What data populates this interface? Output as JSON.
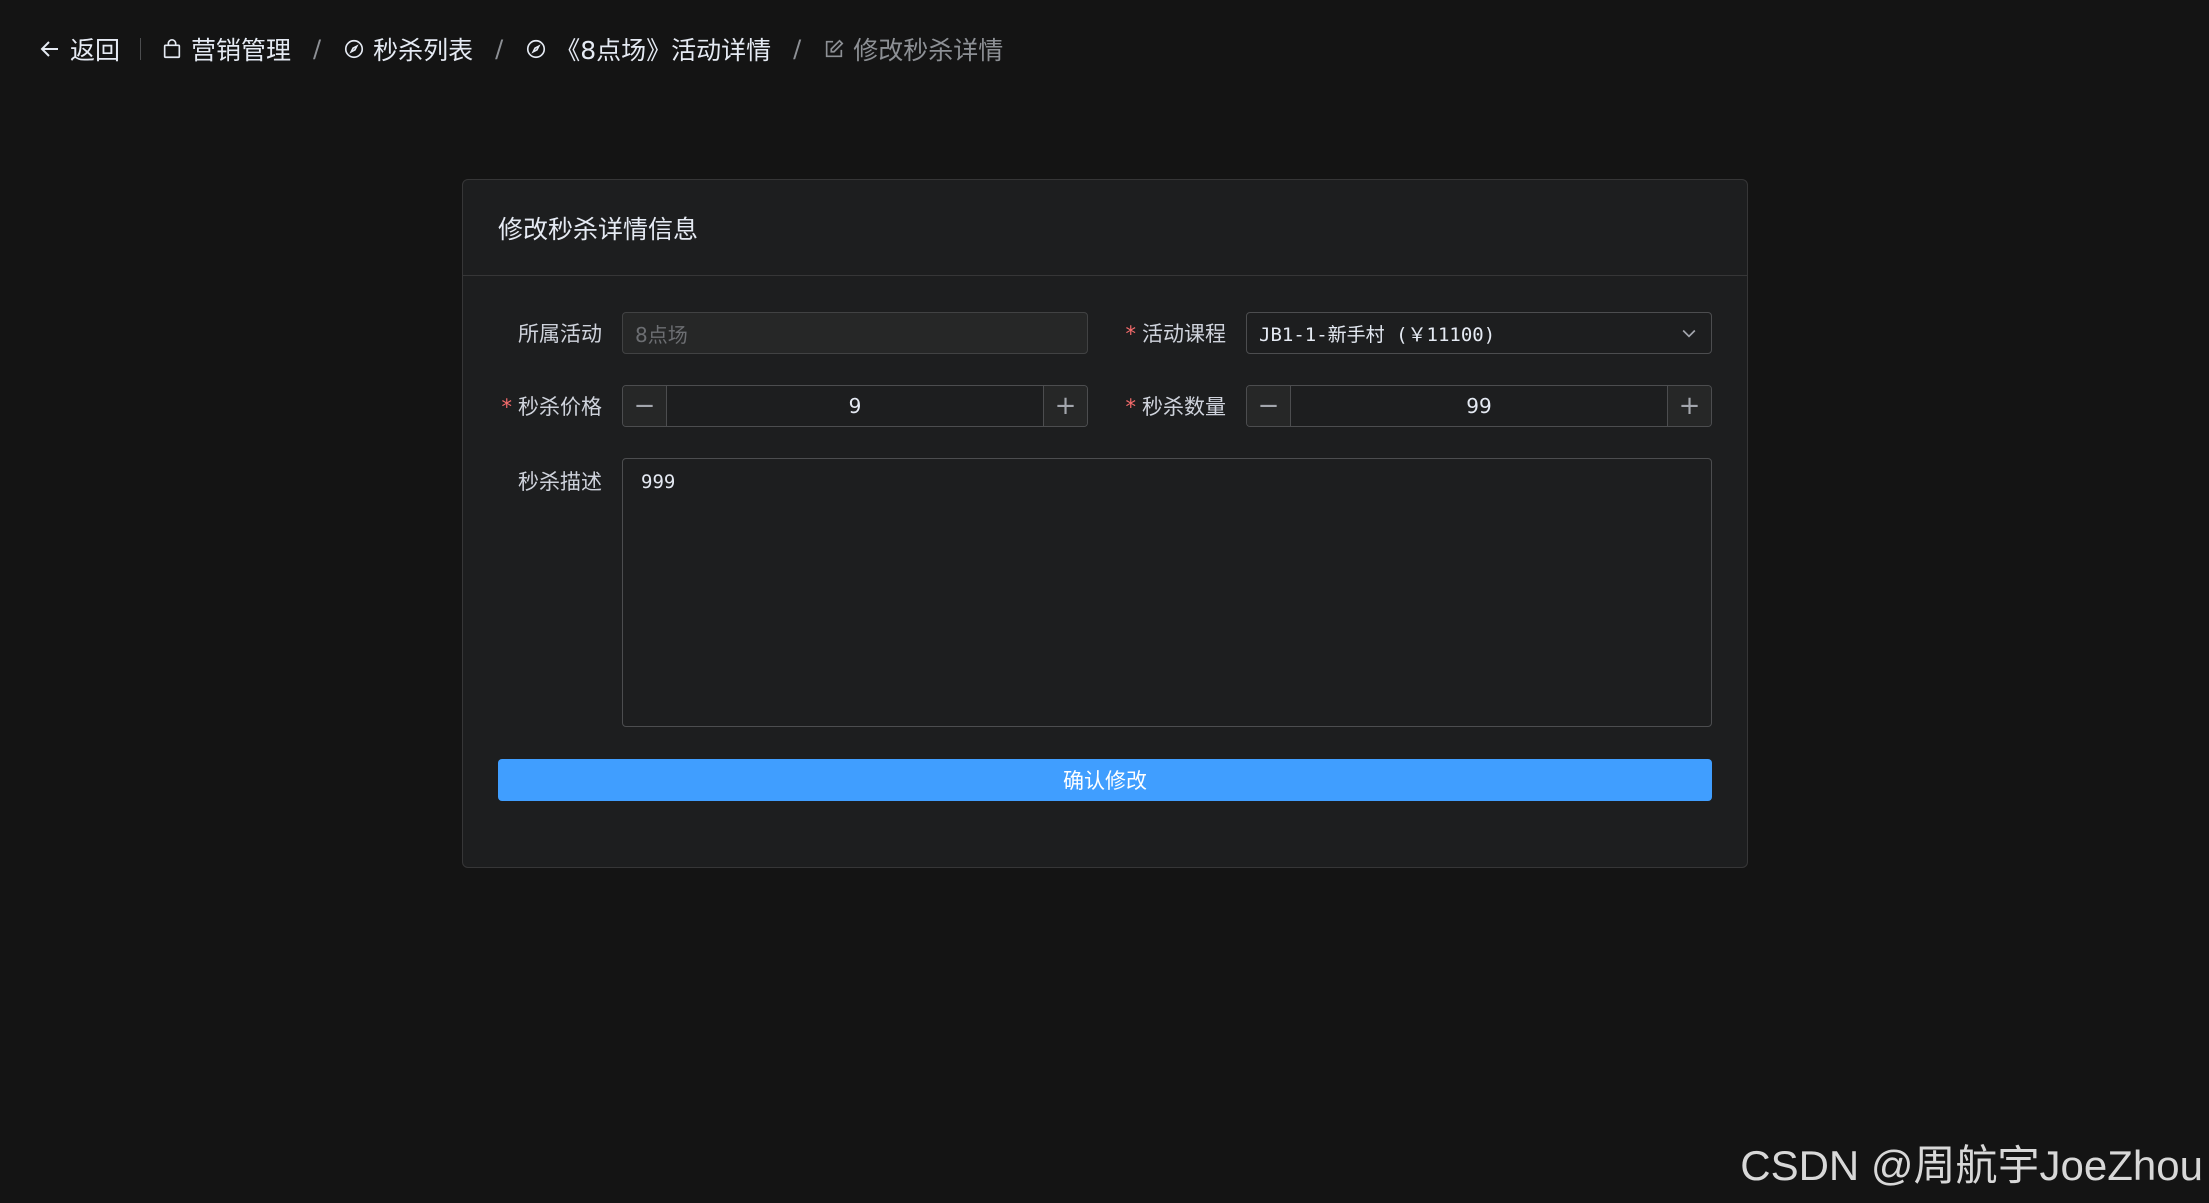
{
  "header": {
    "back_label": "返回",
    "breadcrumbs": [
      {
        "label": "营销管理",
        "icon": "bag-icon"
      },
      {
        "label": "秒杀列表",
        "icon": "compass-icon"
      },
      {
        "label": "《8点场》活动详情",
        "icon": "compass-icon"
      },
      {
        "label": "修改秒杀详情",
        "icon": "edit-icon"
      }
    ],
    "separator": "/"
  },
  "card": {
    "title": "修改秒杀详情信息"
  },
  "form": {
    "activity": {
      "label": "所属活动",
      "placeholder": "8点场",
      "required": false
    },
    "course": {
      "label": "活动课程",
      "value": "JB1-1-新手村 (￥11100)",
      "required": true
    },
    "price": {
      "label": "秒杀价格",
      "value": "9",
      "required": true
    },
    "quantity": {
      "label": "秒杀数量",
      "value": "99",
      "required": true
    },
    "description": {
      "label": "秒杀描述",
      "value": "999"
    },
    "required_mark": "*",
    "stepper_minus": "−",
    "stepper_plus": "+",
    "submit_label": "确认修改"
  },
  "watermark": "CSDN @周航宇JoeZhou",
  "colors": {
    "background": "#141414",
    "card": "#1d1e1f",
    "primary": "#409eff",
    "required": "#f56c6c"
  }
}
